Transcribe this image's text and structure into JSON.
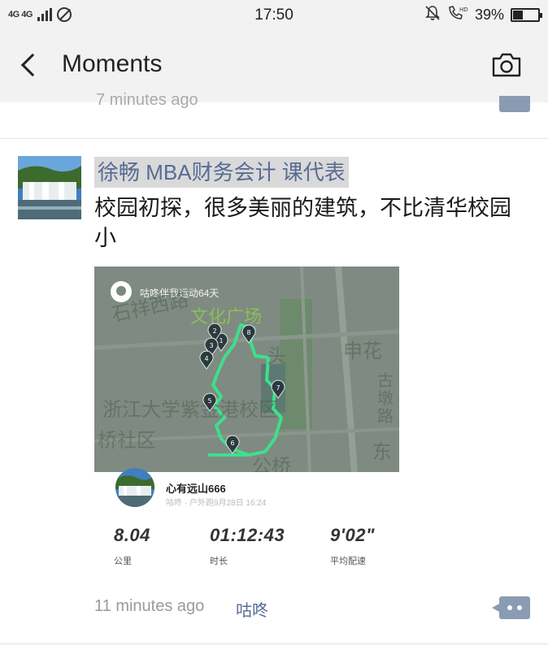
{
  "status_bar": {
    "network": "4G 4G",
    "time": "17:50",
    "battery_percent": "39%",
    "battery_level": 0.39,
    "icons": [
      "signal-icon",
      "do-not-disturb-icon",
      "mute-bell-icon",
      "hd-call-icon",
      "battery-icon"
    ]
  },
  "nav": {
    "title": "Moments"
  },
  "previous_post": {
    "time": "7 minutes ago"
  },
  "post": {
    "author": "徐畅  MBA财务会计 课代表",
    "text": "校园初探，很多美丽的建筑，不比清华校园小",
    "time": "11 minutes ago",
    "source": "咕咚"
  },
  "card": {
    "badge": "咕咚伴我运动64天",
    "map_labels": {
      "road": "石祥西路",
      "plaza": "文化广场",
      "campus": "浙江大学紫金港校区",
      "community": "桥社区",
      "shenhua": "申花",
      "side_road": "古墩路",
      "east": "东",
      "bridge": "公桥",
      "tou": "头"
    },
    "markers": [
      "1",
      "2",
      "3",
      "4",
      "5",
      "6",
      "7",
      "8"
    ],
    "runner": {
      "name": "心有远山666",
      "meta": "咕咚 · 户外跑9月28日 16:24"
    },
    "stats": [
      {
        "value": "8.04",
        "label": "公里"
      },
      {
        "value": "01:12:43",
        "label": "时长"
      },
      {
        "value": "9'02\"",
        "label": "平均配速"
      }
    ]
  },
  "colors": {
    "link": "#576b95",
    "route": "#3de08a",
    "map_bg": "#7f8a82"
  }
}
